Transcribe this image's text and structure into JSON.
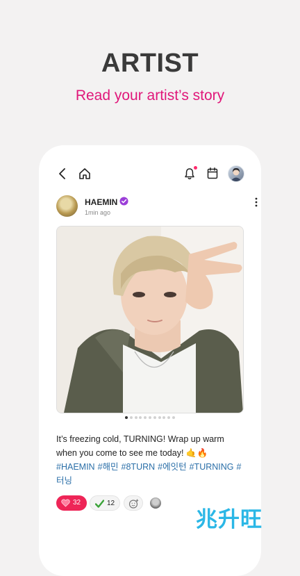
{
  "screen": {
    "headline": "ARTIST",
    "subheadline": "Read your artist’s story"
  },
  "topbar": {
    "icons": [
      "back-arrow-icon",
      "home-icon",
      "bell-icon",
      "calendar-icon",
      "profile-avatar"
    ],
    "has_notification": true
  },
  "post": {
    "author": "HAEMIN",
    "time": "1min ago",
    "verified": true,
    "image_count": 11,
    "active_image_index": 0,
    "caption": "It’s freezing cold, TURNING! Wrap up warm when you come to see me today! 🤙🔥",
    "hashtags": [
      "#HAEMIN",
      "#해민",
      "#8TURN",
      "#에잇턴",
      "#TURNING",
      "#터닝"
    ],
    "reactions": {
      "hearts": "32",
      "checks": "12"
    }
  },
  "watermark": "兆升旺",
  "colors": {
    "accent": "#e0177a",
    "heart": "#ee2557",
    "hashtag": "#2b6fa8",
    "watermark": "#2bb7e6"
  }
}
